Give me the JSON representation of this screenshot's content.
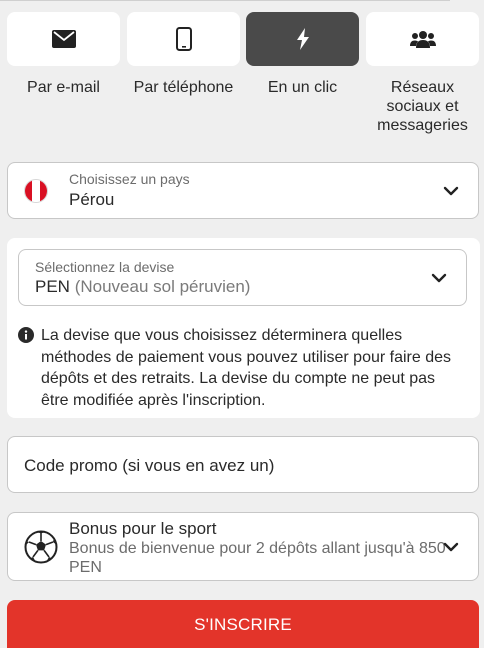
{
  "registration_tabs": [
    {
      "label": "Par e-mail",
      "icon": "envelope-icon",
      "active": false
    },
    {
      "label": "Par téléphone",
      "icon": "phone-icon",
      "active": false
    },
    {
      "label": "En un clic",
      "icon": "lightning-icon",
      "active": true
    },
    {
      "label": "Réseaux sociaux et messageries",
      "icon": "users-icon",
      "active": false
    }
  ],
  "country": {
    "label": "Choisissez un pays",
    "value": "Pérou",
    "flag_colors": [
      "#d91023",
      "#ffffff",
      "#d91023"
    ]
  },
  "currency": {
    "label": "Sélectionnez la devise",
    "code": "PEN",
    "name": "(Nouveau sol péruvien)",
    "info": "La devise que vous choisissez déterminera quelles méthodes de paiement vous pouvez utiliser pour faire des dépôts et des retraits. La devise du compte ne peut pas être modifiée après l'inscription."
  },
  "promo": {
    "placeholder": "Code promo (si vous en avez un)"
  },
  "bonus": {
    "title": "Bonus pour le sport",
    "description": "Bonus de bienvenue pour 2 dépôts allant jusqu'à 850 PEN"
  },
  "submit": {
    "label": "S'INSCRIRE",
    "color": "#e3342a"
  },
  "colors": {
    "active_tab": "#4a4a4a",
    "background": "#efefef"
  }
}
